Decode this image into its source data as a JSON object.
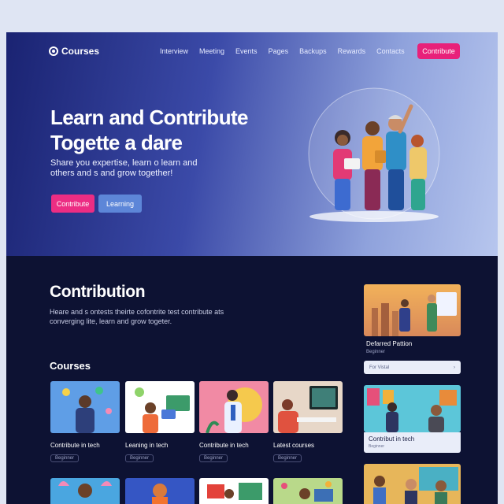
{
  "header": {
    "logo_text": "Courses",
    "nav": [
      "Interview",
      "Meeting",
      "Events",
      "Pages",
      "Backups",
      "Rewards",
      "Contacts"
    ],
    "cta_label": "Contribute"
  },
  "hero": {
    "title_line1": "Learn and Contribute",
    "title_line2": "Togette a dare",
    "subtitle": "Share you expertise, learn o learn and others and s and grow together!",
    "primary_button": "Contribute",
    "secondary_button": "Learning"
  },
  "contribution": {
    "title": "Contribution",
    "description": "Heare and s ontests theirte cofontrite test contribute ats converging lite, learn and grow togeter."
  },
  "courses": {
    "heading": "Courses",
    "items": [
      {
        "title": "Contribute in tech",
        "tag": "Beginner"
      },
      {
        "title": "Leaning in tech",
        "tag": "Beginner"
      },
      {
        "title": "Contribute in tech",
        "tag": "Beginner"
      },
      {
        "title": "Latest courses",
        "tag": "Beginner"
      }
    ]
  },
  "featured": {
    "title": "Defarred Pattion",
    "subtitle": "Beginner",
    "bar_label": "For Vistal",
    "card2_title": "Contribut in tech",
    "card2_subtitle": "Beginner"
  },
  "colors": {
    "accent_pink": "#e8217a",
    "accent_blue": "#5d86d8",
    "dark_bg": "#0d1233"
  }
}
